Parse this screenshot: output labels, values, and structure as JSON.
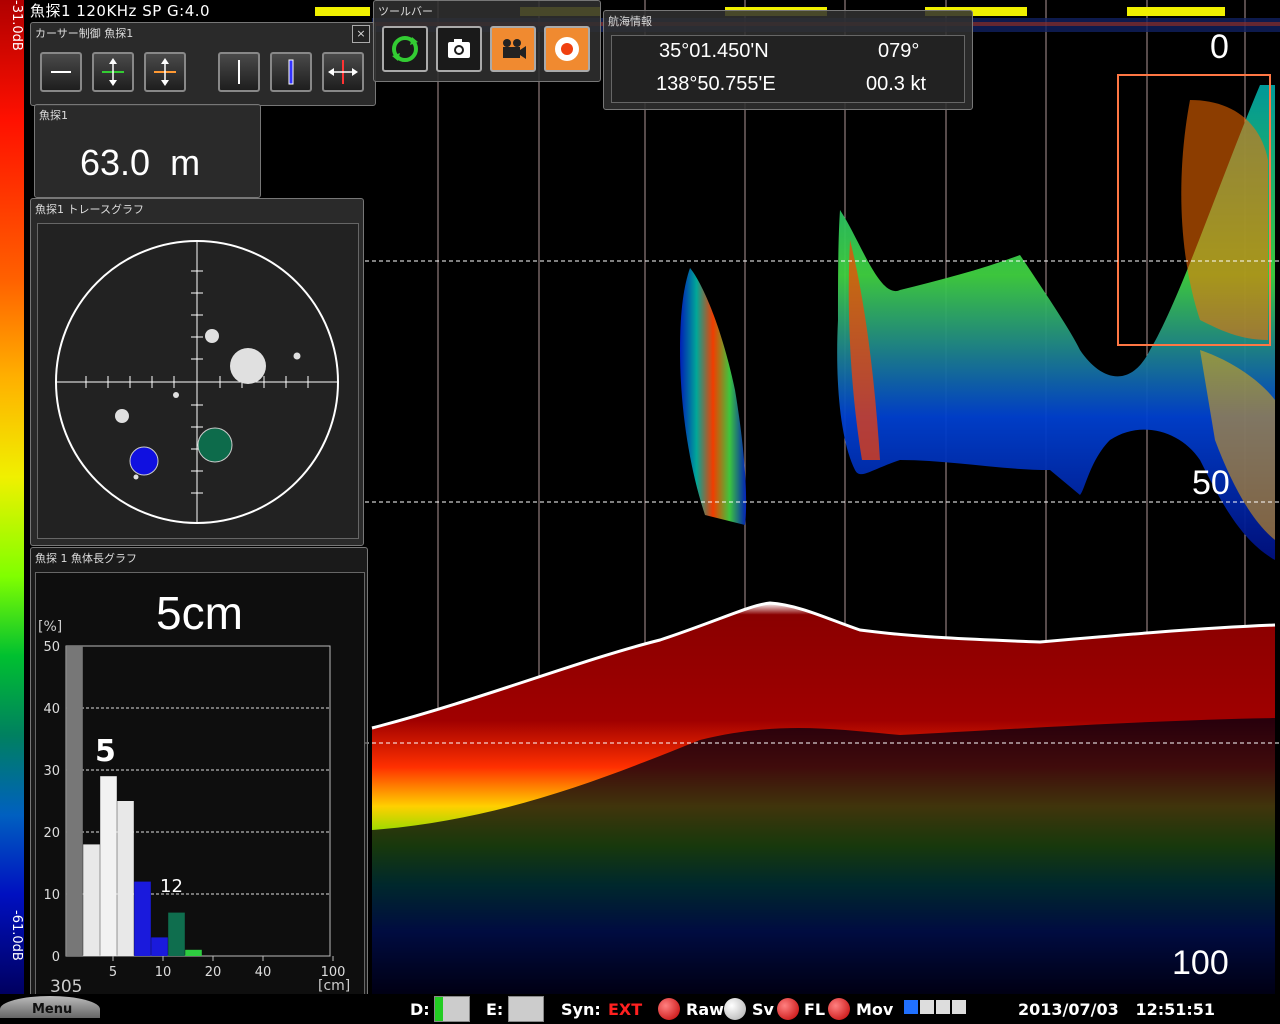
{
  "title_bar": "魚探1   120KHz SP    G:4.0",
  "gain_scale": {
    "top": "-31.0dB",
    "bottom": "-61.0dB"
  },
  "depth_labels": {
    "top": "0",
    "mid": "50",
    "bottom": "100"
  },
  "cursor_panel": {
    "title": "カーサー制御  魚探1",
    "close": "×"
  },
  "toolbar": {
    "title": "ツールバー"
  },
  "nav_panel": {
    "title": "航海情報",
    "lat": "35°01.450'N",
    "lon": "138°50.755'E",
    "heading": "079°",
    "speed": "00.3 kt"
  },
  "depth_panel": {
    "title": "魚探1",
    "value": "63.0  m"
  },
  "trace_panel": {
    "title": "魚探1  トレースグラフ"
  },
  "length_panel": {
    "title": "魚探 1  魚体長グラフ",
    "headline": "5cm",
    "unit_y": "[%]",
    "unit_x": "[cm]",
    "count": "305",
    "peak_label": "5",
    "secondary_label": "12"
  },
  "length_chart": {
    "chart_data": {
      "type": "bar",
      "ylim": [
        0,
        50
      ],
      "yticks": [
        "0",
        "10",
        "20",
        "30",
        "40",
        "50"
      ],
      "xticks": [
        "5",
        "10",
        "20",
        "40",
        "100"
      ],
      "values": [
        50,
        18,
        29,
        25,
        12,
        3,
        7,
        1
      ],
      "colors": [
        "#777777",
        "#e8e8e8",
        "#f2f2f2",
        "#e8e8e8",
        "#1a1adc",
        "#1a1adc",
        "#0f6e4e",
        "#2ecc40"
      ]
    }
  },
  "status_bar": {
    "menu": "Menu",
    "d_label": "D:",
    "e_label": "E:",
    "syn_label": "Syn:",
    "syn_value": "EXT",
    "raw": "Raw",
    "sv": "Sv",
    "fl": "FL",
    "mov": "Mov",
    "datetime": "2013/07/03   12:51:51"
  },
  "colors": {
    "accent": "#ff7722",
    "ext_red": "#ff2020",
    "panel_bg": "#303030"
  }
}
